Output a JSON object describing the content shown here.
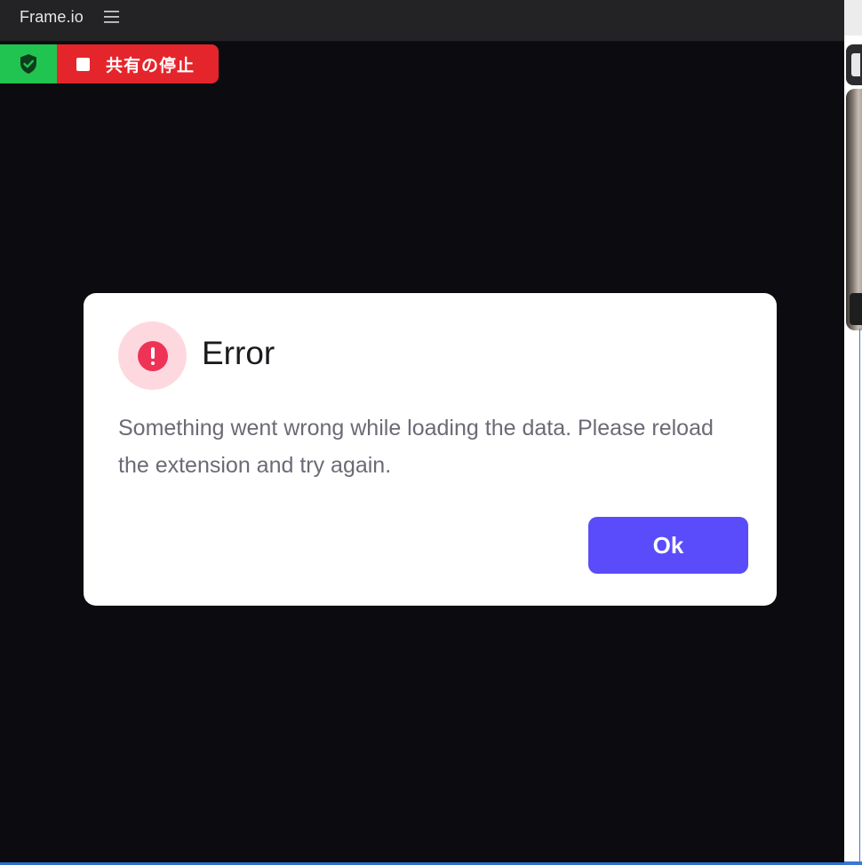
{
  "app": {
    "title": "Frame.io",
    "menu_icon": "hamburger-menu-icon"
  },
  "share_bar": {
    "shield_icon": "shield-check-icon",
    "stop_icon": "stop-square-icon",
    "stop_label": "共有の停止",
    "colors": {
      "shield_bg": "#22c451",
      "stop_bg": "#e5252c"
    }
  },
  "dialog": {
    "icon": "error-exclamation-icon",
    "title": "Error",
    "message": "Something went wrong while loading the data. Please reload the extension and try again.",
    "ok_label": "Ok",
    "colors": {
      "accent": "#5a4cfa",
      "error": "#ef3357",
      "error_bg": "#fdd9df"
    }
  }
}
